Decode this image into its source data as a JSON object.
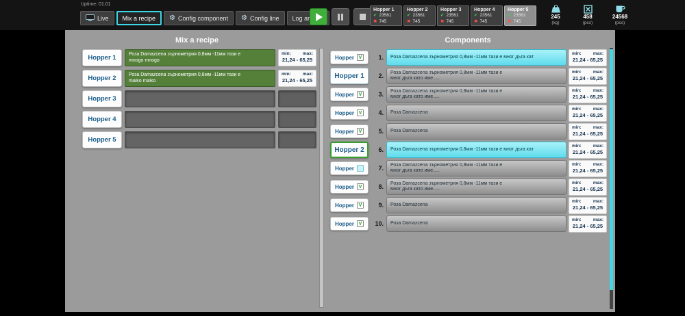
{
  "colors": {
    "accent_cyan": "#3fd6e6",
    "recipe_green": "#55803a",
    "selected_row_cyan": "#5fdcec",
    "ok_green": "#3fdd4a",
    "error_red": "#ff5544",
    "main_background": "#9b9b9b"
  },
  "topbar": {
    "uptime": "Uptime: 01.01",
    "icons": {
      "gear": "⚙",
      "check": "✔",
      "cross": "✖"
    },
    "tabs": {
      "live": "Live",
      "mix": "Mix a recipe",
      "config_component": "Config component",
      "config_line": "Config line",
      "log_archive": "Log archive"
    },
    "hoppers": [
      {
        "name": "Hopper 1",
        "ok": "23561",
        "bad": "745"
      },
      {
        "name": "Hopper 2",
        "ok": "23561",
        "bad": "745"
      },
      {
        "name": "Hopper 3",
        "ok": "23561",
        "bad": "745"
      },
      {
        "name": "Hopper 4",
        "ok": "23561",
        "bad": "745"
      },
      {
        "name": "Hopper 5",
        "ok": "23561",
        "bad": "745"
      }
    ],
    "stats": [
      {
        "icon": "scale-icon",
        "value": "245",
        "unit": "(kg)"
      },
      {
        "icon": "reject-box-icon",
        "value": "458",
        "unit": "(pcs)"
      },
      {
        "icon": "cup-icon",
        "value": "24568",
        "unit": "(pcs)"
      }
    ]
  },
  "recipe": {
    "title": "Mix a recipe",
    "min_label": "min:",
    "max_label": "max:",
    "rows": [
      {
        "hopper": "Hopper 1",
        "line1": "Роза Damazcena зърнометрия 0,8мм -11мм тази е",
        "line2": "mnogo mnogo",
        "range": "21,24 - 65,25"
      },
      {
        "hopper": "Hopper 2",
        "line1": "Роза Damazcena зърнометрия 0,8мм -11мм тази е",
        "line2": "malko malko",
        "range": "21,24 - 65,25"
      },
      {
        "hopper": "Hopper 3"
      },
      {
        "hopper": "Hopper 4"
      },
      {
        "hopper": "Hopper 5"
      }
    ]
  },
  "components": {
    "title": "Components",
    "min_label": "min:",
    "max_label": "max:",
    "selectors": [
      {
        "label": "Hopper",
        "check": "V"
      },
      {
        "label": "Hopper 1"
      },
      {
        "label": "Hopper",
        "check": "V"
      },
      {
        "label": "Hopper",
        "check": "V"
      },
      {
        "label": "Hopper",
        "check": "V"
      },
      {
        "label": "Hopper 2"
      },
      {
        "label": "Hopper",
        "check": ""
      },
      {
        "label": "Hopper",
        "check": "V"
      },
      {
        "label": "Hopper",
        "check": "V"
      },
      {
        "label": "Hopper",
        "check": "V"
      }
    ],
    "items": [
      {
        "num": "1.",
        "line1": "Роза Damazcena зърнометрия 0,8мм -11мм тази е  мног дъга кат",
        "line2": "",
        "range": "21,24 - 65,25"
      },
      {
        "num": "2.",
        "line1": "Роза Damazcena зърнометрия 0,8мм -11мм тази е",
        "line2": "мног дъга като име.....",
        "range": "21,24 - 65,25"
      },
      {
        "num": "3.",
        "line1": "Роза Damazcena зърнометрия 0,8мм -11мм тази е",
        "line2": "мног дъга като име.....",
        "range": "21,24 - 65,25"
      },
      {
        "num": "4.",
        "line1": "Роза Damazcena",
        "line2": "",
        "range": "21,24 - 65,25"
      },
      {
        "num": "5.",
        "line1": "Роза Damazcena",
        "line2": "",
        "range": "21,24 - 65,25"
      },
      {
        "num": "6.",
        "line1": "Роза Damazcena зърнометрия 0,8мм -11мм тази е  мног дъга кат",
        "line2": "",
        "range": "21,24 - 65,25"
      },
      {
        "num": "7.",
        "line1": "Роза Damazcena зърнометрия 0,8мм -11мм тази е",
        "line2": "мног дъга като име.....",
        "range": "21,24 - 65,25"
      },
      {
        "num": "8.",
        "line1": "Роза Damazcena зърнометрия 0,8мм -11мм тази е",
        "line2": "мног дъга като име.....",
        "range": "21,24 - 65,25"
      },
      {
        "num": "9.",
        "line1": "Роза Damazcena",
        "line2": "",
        "range": "21,24 - 65,25"
      },
      {
        "num": "10.",
        "line1": "Роза Damazcena",
        "line2": "",
        "range": "21,24 - 65,25"
      }
    ]
  }
}
